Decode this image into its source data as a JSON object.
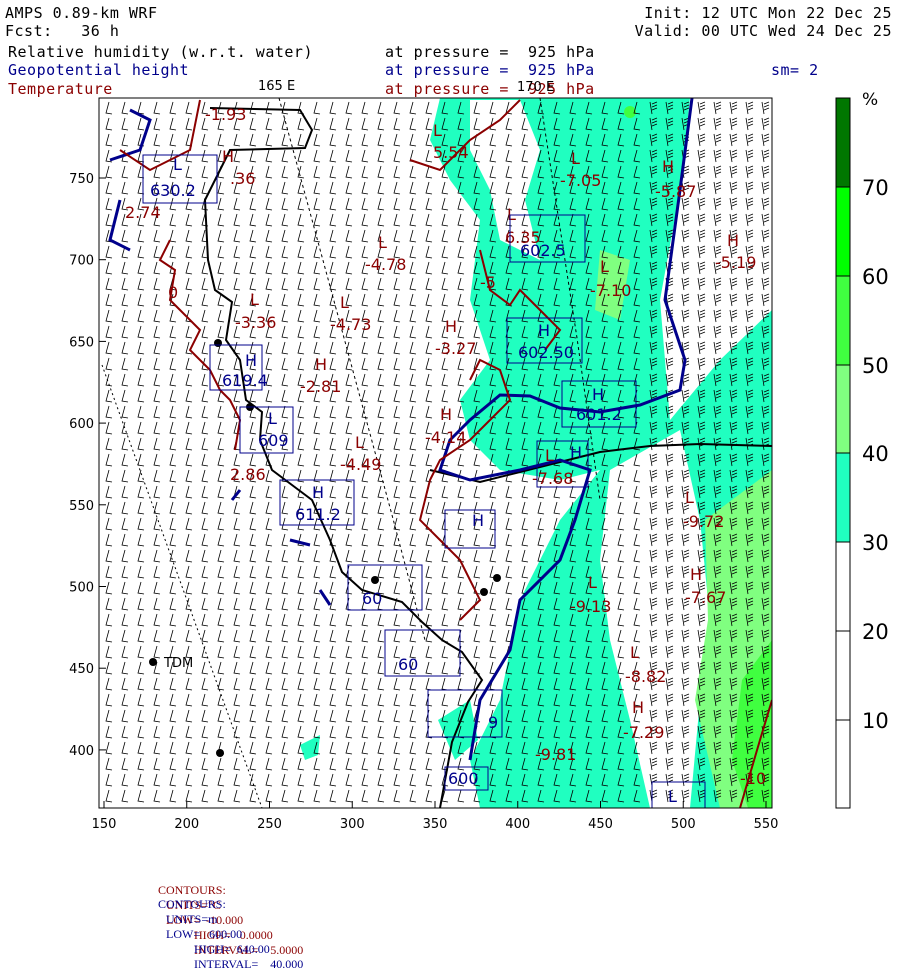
{
  "header": {
    "model": "AMPS 0.89-km WRF",
    "fcst": "Fcst:   36 h",
    "init": "Init: 12 UTC Mon 22 Dec 25",
    "valid": "Valid: 00 UTC Wed 24 Dec 25",
    "field1": "Relative humidity (w.r.t. water)",
    "field1_level": "at pressure =  925 hPa",
    "field2": "Geopotential height",
    "field2_level": "at pressure =  925 hPa",
    "smoothing": "sm= 2",
    "field3": "Temperature",
    "field3_level": "at pressure =  925 hPa"
  },
  "map": {
    "meridian_labels": [
      "165 E",
      "170 E"
    ],
    "x_ticks": [
      "150",
      "200",
      "250",
      "300",
      "350",
      "400",
      "450",
      "500",
      "550"
    ],
    "y_ticks": [
      "750",
      "700",
      "650",
      "600",
      "550",
      "500",
      "450",
      "400"
    ],
    "station": "TDM",
    "temperature_labels": [
      "-1.93",
      "H",
      ".36",
      "2.74",
      "0",
      "L",
      "-3.36",
      "L",
      "-4.73",
      "L",
      "-4.78",
      "H",
      "-2.81",
      "L",
      "-4.49",
      "2.86",
      "L",
      "5.54",
      "L",
      "-7.05",
      "H",
      "-5.87",
      "H",
      "-5.19",
      "L",
      "6.35",
      "-5",
      "L",
      "-7.10",
      "H",
      "-3.27",
      "H",
      "-4.14",
      "L",
      "-7.68",
      "L",
      "-9.72",
      "H",
      "-7.67",
      "L",
      "-9.13",
      "L",
      "-8.82",
      "H",
      "-7.29",
      "-9.81",
      "-10"
    ],
    "height_labels": [
      "L",
      "630.2",
      "H",
      "619.4",
      "L",
      "609",
      "H",
      "611.2",
      "602.5",
      "H",
      "602.50",
      "H",
      "601.2",
      "H",
      "H",
      "60",
      "60",
      "9",
      "600",
      "L"
    ]
  },
  "colorbar": {
    "unit": "%",
    "labels": [
      "70",
      "60",
      "50",
      "40",
      "30",
      "20",
      "10"
    ],
    "colors": [
      "#007700",
      "#00ff00",
      "#40ff40",
      "#80ff80",
      "#20ffc0",
      "#ffffff"
    ]
  },
  "footer": {
    "temp": {
      "contours": "CONTOURS:",
      "units": "UNITS=°C",
      "low": "LOW=  -10.000",
      "high": "HIGH=   0.0000",
      "interval": "INTERVAL=    5.0000",
      "color": "#8b0000"
    },
    "height": {
      "contours": "CONTOURS:",
      "units": "UNITS=m",
      "low": "LOW=   600.00",
      "high": "HIGH=  640.00",
      "interval": "INTERVAL=    40.000",
      "color": "#00008b"
    }
  }
}
